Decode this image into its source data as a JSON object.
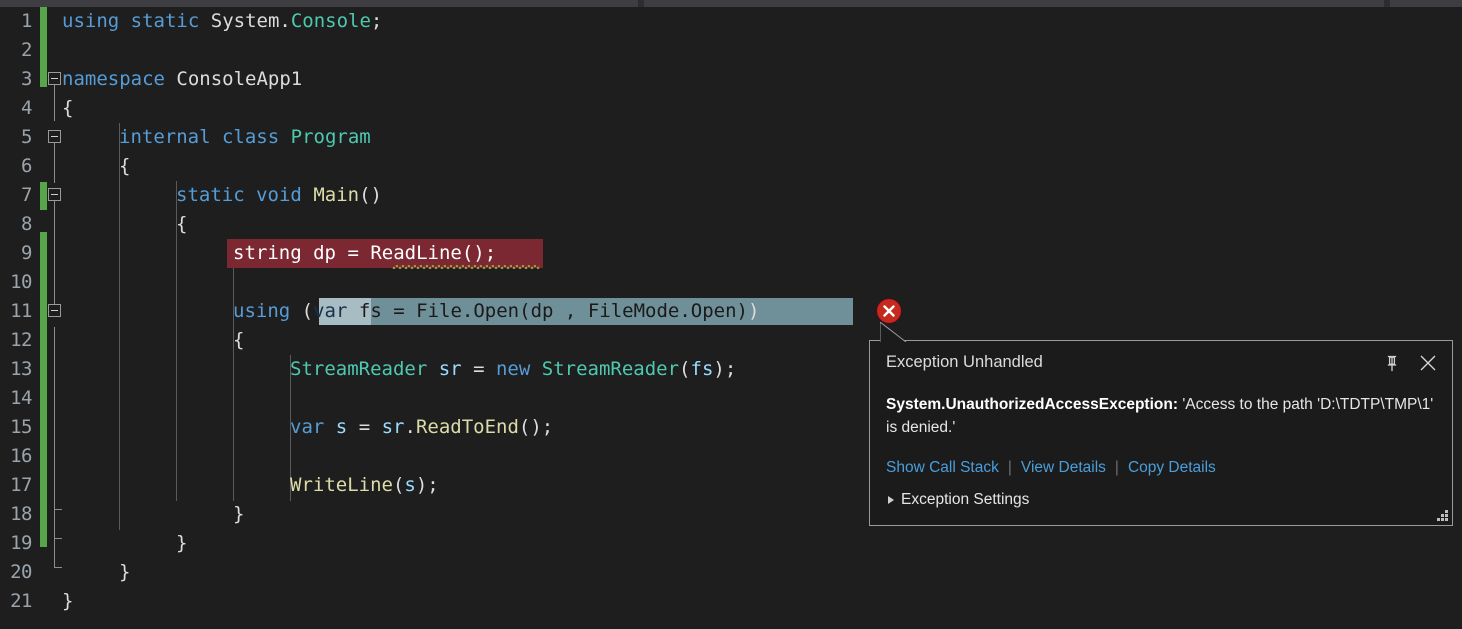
{
  "editor": {
    "theme_background": "#1e1e1e",
    "gutter_change_color": "#57a64a",
    "breakpoint_line_background": "#7c2833",
    "current_statement_background": "#6f9099",
    "keyword_color": "#569cd6",
    "type_color": "#4ec9b0",
    "local_color": "#9cdcfe",
    "method_color": "#dcdcaa",
    "lines": [
      {
        "number": "1",
        "text": "using static System.Console;"
      },
      {
        "number": "2",
        "text": ""
      },
      {
        "number": "3",
        "text": "namespace ConsoleApp1"
      },
      {
        "number": "4",
        "text": "{"
      },
      {
        "number": "5",
        "text": "    internal class Program"
      },
      {
        "number": "6",
        "text": "    {"
      },
      {
        "number": "7",
        "text": "        static void Main()"
      },
      {
        "number": "8",
        "text": "        {"
      },
      {
        "number": "9",
        "text": "            string dp = ReadLine();"
      },
      {
        "number": "10",
        "text": ""
      },
      {
        "number": "11",
        "text": "            using (var fs = File.Open(dp , FileMode.Open))"
      },
      {
        "number": "12",
        "text": "            {"
      },
      {
        "number": "13",
        "text": "                StreamReader sr = new StreamReader(fs);"
      },
      {
        "number": "14",
        "text": ""
      },
      {
        "number": "15",
        "text": "                var s = sr.ReadToEnd();"
      },
      {
        "number": "16",
        "text": ""
      },
      {
        "number": "17",
        "text": "                WriteLine(s);"
      },
      {
        "number": "18",
        "text": "            }"
      },
      {
        "number": "19",
        "text": "        }"
      },
      {
        "number": "20",
        "text": "    }"
      },
      {
        "number": "21",
        "text": "}"
      }
    ],
    "tokens": {
      "l1_using": "using",
      "l1_static": "static",
      "l1_system": "System",
      "l1_dot": ".",
      "l1_console": "Console",
      "l1_semi": ";",
      "l3_namespace": "namespace",
      "l3_name": "ConsoleApp1",
      "l4_brace": "{",
      "l5_internal": "internal",
      "l5_class": "class",
      "l5_program": "Program",
      "l6_brace": "{",
      "l7_static": "static",
      "l7_void": "void",
      "l7_main": "Main",
      "l7_parens": "()",
      "l8_brace": "{",
      "l9_string": "string",
      "l9_dp": "dp",
      "l9_eq": "=",
      "l9_readline": "ReadLine",
      "l9_tail": "();",
      "l11_using": "using",
      "l11_open_paren": "(",
      "l11_var": "var",
      "l11_fs": "fs",
      "l11_eq": "=",
      "l11_file": "File",
      "l11_dot1": ".",
      "l11_open": "Open",
      "l11_paren2": "(",
      "l11_dp": "dp",
      "l11_comma": " ,",
      "l11_filemode": "FileMode",
      "l11_dot2": ".",
      "l11_openmode": "Open",
      "l11_close_inner": ")",
      "l11_close_outer": ")",
      "l12_brace": "{",
      "l13_streamreader": "StreamReader",
      "l13_sr": "sr",
      "l13_eq": "=",
      "l13_new": "new",
      "l13_streamreader2": "StreamReader",
      "l13_paren1": "(",
      "l13_fs": "fs",
      "l13_tail": ");",
      "l15_var": "var",
      "l15_s": "s",
      "l15_eq": "=",
      "l15_sr": "sr",
      "l15_dot": ".",
      "l15_readtoend": "ReadToEnd",
      "l15_tail": "();",
      "l17_writeline": "WriteLine",
      "l17_paren": "(",
      "l17_s": "s",
      "l17_tail": ");",
      "l18_brace": "}",
      "l19_brace": "}",
      "l20_brace": "}",
      "l21_brace": "}"
    }
  },
  "exception_popup": {
    "title": "Exception Unhandled",
    "exception_type": "System.UnauthorizedAccessException:",
    "exception_message": " 'Access to the path 'D:\\TDTP\\TMP\\1' is denied.'",
    "links": [
      {
        "label": "Show Call Stack"
      },
      {
        "label": "View Details"
      },
      {
        "label": "Copy Details"
      }
    ],
    "link_separator": "|",
    "settings_label": "Exception Settings",
    "pin_icon": "pin-icon",
    "close_icon": "close-icon",
    "marker_icon": "error-x-icon",
    "link_color": "#4a9eda",
    "border_color": "#9a9a9a",
    "background_color": "#1b1b1c"
  }
}
